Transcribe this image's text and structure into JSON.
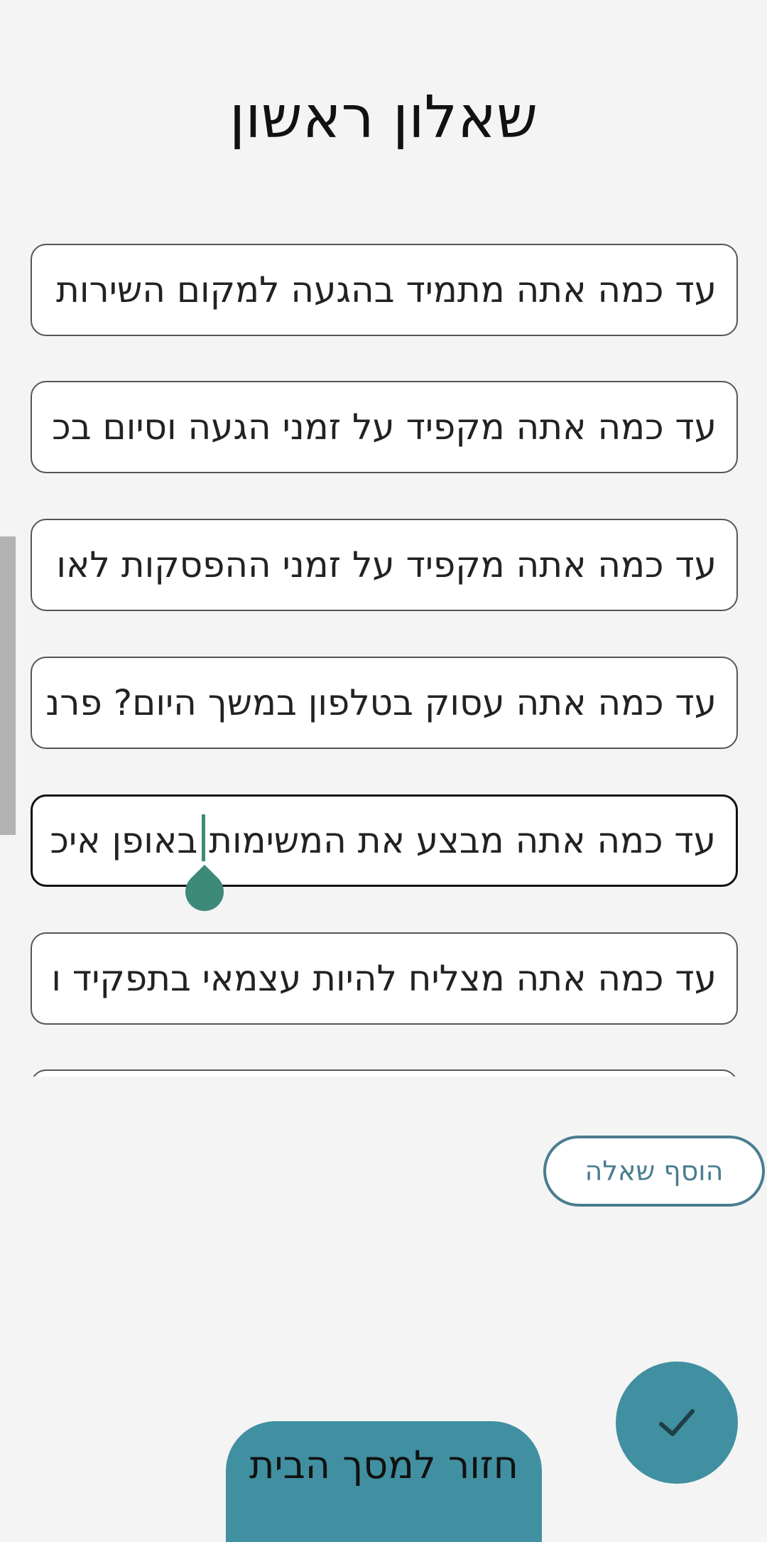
{
  "header": {
    "title": "שאלון ראשון"
  },
  "questions": [
    {
      "text": "עד כמה אתה מתמיד בהגעה למקום השירות"
    },
    {
      "text": "עד כמה אתה מקפיד על זמני הגעה וסיום בכ"
    },
    {
      "text": "עד כמה אתה מקפיד  על זמני ההפסקות לאו"
    },
    {
      "text": "עד כמה אתה עסוק בטלפון במשך היום? פרנ"
    },
    {
      "text": "עד כמה אתה מבצע את המשימות באופן איכ"
    },
    {
      "text": "עד כמה אתה מצליח להיות עצמאי בתפקיד ו"
    }
  ],
  "actions": {
    "add_question": "הוסף שאלה",
    "back_home": "חזור למסך הבית"
  },
  "icons": {
    "fab": "check-icon"
  },
  "colors": {
    "accent": "#4190a1",
    "cursor": "#3e8a78",
    "outline": "#4a7d8f"
  }
}
